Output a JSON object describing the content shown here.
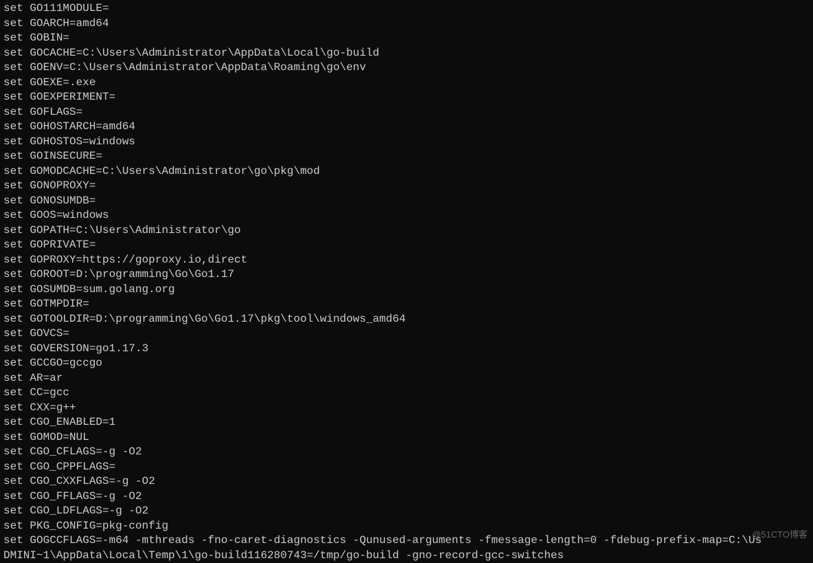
{
  "lines": [
    "set GO111MODULE=",
    "set GOARCH=amd64",
    "set GOBIN=",
    "set GOCACHE=C:\\Users\\Administrator\\AppData\\Local\\go-build",
    "set GOENV=C:\\Users\\Administrator\\AppData\\Roaming\\go\\env",
    "set GOEXE=.exe",
    "set GOEXPERIMENT=",
    "set GOFLAGS=",
    "set GOHOSTARCH=amd64",
    "set GOHOSTOS=windows",
    "set GOINSECURE=",
    "set GOMODCACHE=C:\\Users\\Administrator\\go\\pkg\\mod",
    "set GONOPROXY=",
    "set GONOSUMDB=",
    "set GOOS=windows",
    "set GOPATH=C:\\Users\\Administrator\\go",
    "set GOPRIVATE=",
    "set GOPROXY=https://goproxy.io,direct",
    "set GOROOT=D:\\programming\\Go\\Go1.17",
    "set GOSUMDB=sum.golang.org",
    "set GOTMPDIR=",
    "set GOTOOLDIR=D:\\programming\\Go\\Go1.17\\pkg\\tool\\windows_amd64",
    "set GOVCS=",
    "set GOVERSION=go1.17.3",
    "set GCCGO=gccgo",
    "set AR=ar",
    "set CC=gcc",
    "set CXX=g++",
    "set CGO_ENABLED=1",
    "set GOMOD=NUL",
    "set CGO_CFLAGS=-g -O2",
    "set CGO_CPPFLAGS=",
    "set CGO_CXXFLAGS=-g -O2",
    "set CGO_FFLAGS=-g -O2",
    "set CGO_LDFLAGS=-g -O2",
    "set PKG_CONFIG=pkg-config",
    "set GOGCCFLAGS=-m64 -mthreads -fno-caret-diagnostics -Qunused-arguments -fmessage-length=0 -fdebug-prefix-map=C:\\Us",
    "DMINI~1\\AppData\\Local\\Temp\\1\\go-build116280743=/tmp/go-build -gno-record-gcc-switches"
  ],
  "watermark": "@51CTO博客"
}
